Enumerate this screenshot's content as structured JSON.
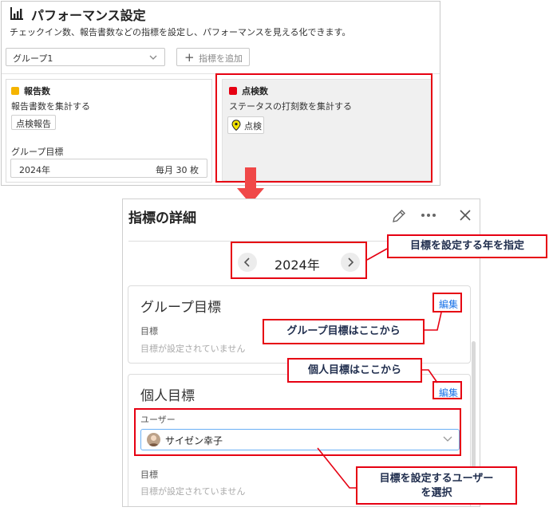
{
  "header": {
    "title": "パフォーマンス設定",
    "description": "チェックイン数、報告書数などの指標を設定し、パフォーマンスを見える化できます。",
    "icon": "bar-chart-icon"
  },
  "toolbar": {
    "group_select_value": "グループ1",
    "add_metric_label": "指標を追加"
  },
  "cards": [
    {
      "title": "報告数",
      "color": "#f5b400",
      "description": "報告書数を集計する",
      "tag": "点検報告",
      "goal_label": "グループ目標",
      "goal_year": "2024年",
      "goal_value": "毎月 30 枚"
    },
    {
      "title": "点検数",
      "color": "#e60012",
      "description": "ステータスの打刻数を集計する",
      "tag": "点検",
      "tag_icon": "map-pin-icon"
    }
  ],
  "detail": {
    "title": "指標の詳細",
    "year": "2024年",
    "group_section": {
      "title": "グループ目標",
      "edit_label": "編集",
      "field_label": "目標",
      "empty_text": "目標が設定されていません"
    },
    "personal_section": {
      "title": "個人目標",
      "edit_label": "編集",
      "user_label": "ユーザー",
      "user_value": "サイゼン幸子",
      "field_label": "目標",
      "empty_text": "目標が設定されていません"
    }
  },
  "callouts": {
    "year": "目標を設定する年を指定",
    "group": "グループ目標はここから",
    "personal": "個人目標はここから",
    "user_line1": "目標を設定するユーザー",
    "user_line2": "を選択"
  },
  "colors": {
    "highlight": "#e60012",
    "callout_text": "#1f2d4d",
    "link": "#1a73e8"
  }
}
